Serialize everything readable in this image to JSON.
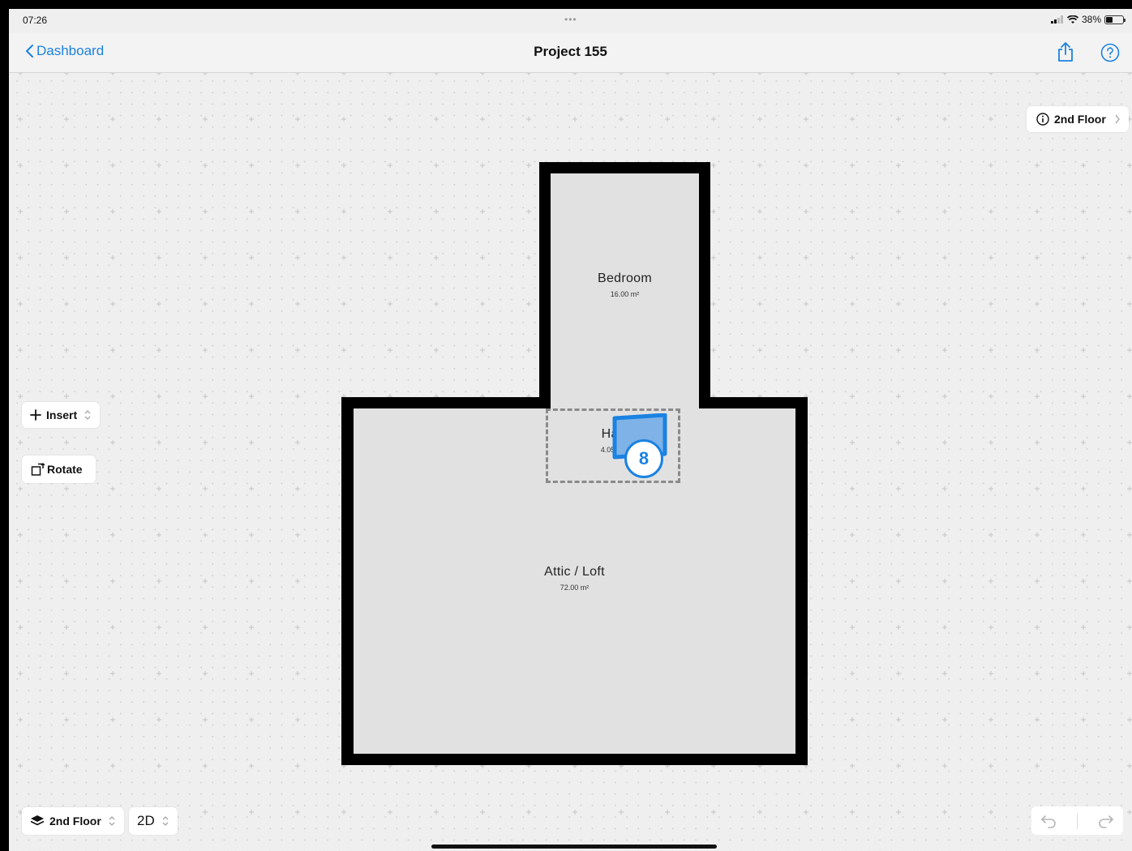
{
  "status": {
    "time": "07:26",
    "dots": "•••",
    "battery": "38%",
    "battery_level": 0.38
  },
  "nav": {
    "back_label": "Dashboard",
    "title": "Project 155",
    "share_icon": "share-icon",
    "help_icon": "help-circle-icon"
  },
  "floor_info": {
    "label": "2nd Floor",
    "icon": "info-icon"
  },
  "tools": {
    "insert_label": "Insert",
    "rotate_label": "Rotate"
  },
  "rooms": [
    {
      "name": "Bedroom",
      "area": "16.00 m²"
    },
    {
      "name": "Hall",
      "area": "4.05 m²"
    },
    {
      "name": "Attic / Loft",
      "area": "72.00 m²"
    }
  ],
  "badge": {
    "number": "8"
  },
  "bottom": {
    "floor_label": "2nd Floor",
    "view_mode": "2D"
  },
  "colors": {
    "accent": "#1a82e2",
    "wall": "#000000",
    "room": "#e1e1e1",
    "canvas": "#efefef"
  }
}
